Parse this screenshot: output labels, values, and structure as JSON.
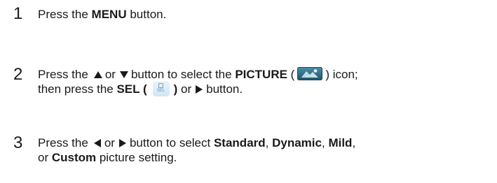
{
  "steps": [
    {
      "number": "1",
      "lines": [
        {
          "t1": "Press the ",
          "b1": "MENU",
          "t2": " button."
        }
      ]
    },
    {
      "number": "2",
      "line1": {
        "t1": "Press the",
        "t2": "or",
        "t3": "button to select the ",
        "b1": "PICTURE",
        "t4": " (",
        "t5": ") icon;"
      },
      "line2": {
        "t1": "then press the ",
        "b1": "SEL (",
        "b2": ")",
        "t2": " or",
        "t3": "button."
      },
      "sel_icon_text": "SEL"
    },
    {
      "number": "3",
      "line1": {
        "t1": "Press the",
        "t2": "or",
        "t3": "button to select ",
        "b1": "Standard",
        "t4": ", ",
        "b2": "Dynamic",
        "t5": ", ",
        "b3": "Mild",
        "t6": ","
      },
      "line2": {
        "t1": "or ",
        "b1": "Custom",
        "t2": " picture setting."
      }
    }
  ],
  "icons": {
    "up": "up-triangle-icon",
    "down": "down-triangle-icon",
    "left": "left-triangle-icon",
    "right": "right-triangle-icon",
    "picture": "picture-icon",
    "sel": "sel-button-icon"
  },
  "colors": {
    "text": "#1a1a1a",
    "picture_icon_bg": "#2e6f86",
    "sel_icon_bg": "#d8ecf8"
  }
}
